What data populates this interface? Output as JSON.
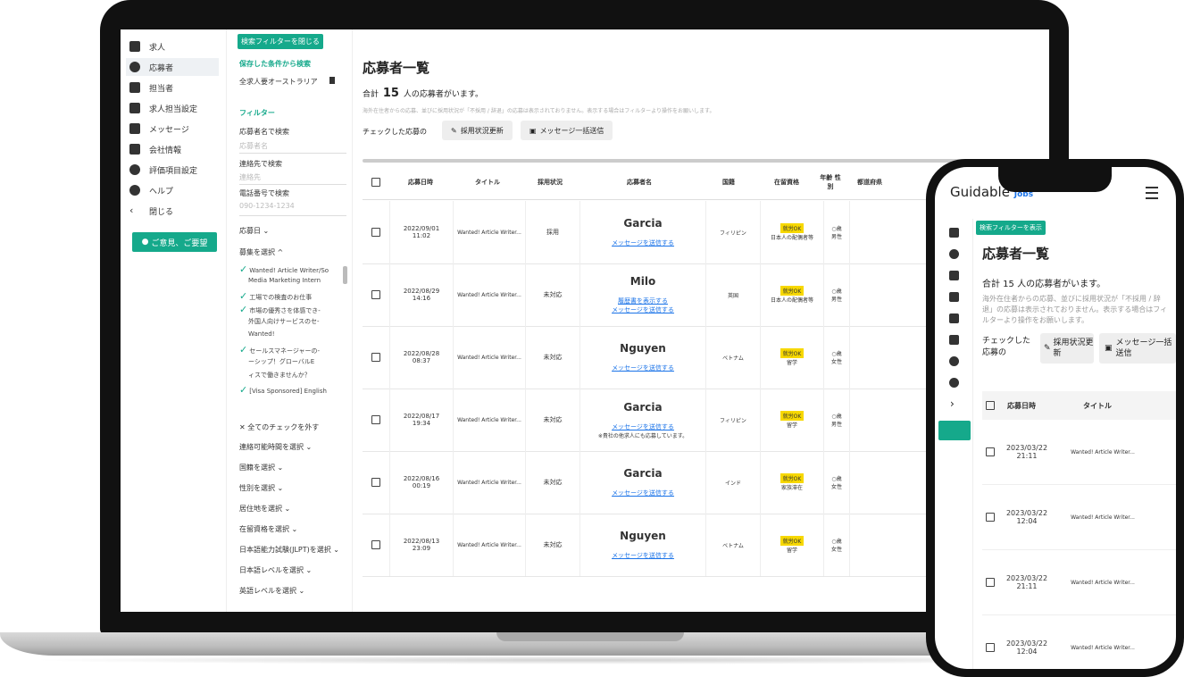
{
  "nav": {
    "items": [
      "求人",
      "応募者",
      "担当者",
      "求人担当設定",
      "メッセージ",
      "会社情報",
      "評価項目設定",
      "ヘルプ",
      "閉じる"
    ],
    "feedback": "ご意見、ご要望"
  },
  "filter": {
    "close_button": "検索フィルターを閉じる",
    "saved_label": "保存した条件から検索",
    "saved_value": "全求人要オーストラリア",
    "filter_title": "フィルター",
    "name_search": "応募者名で検索",
    "name_placeholder": "応募者名",
    "email_search": "連絡先で検索",
    "email_placeholder": "連絡先",
    "phone_search": "電話番号で検索",
    "phone_placeholder": "090-1234-1234",
    "apply_date": "応募日 ⌄",
    "job_select": "募集を選択 ^",
    "jobs": [
      {
        "checked": true,
        "label": "Wanted! Article Writer/So"
      },
      {
        "checked": false,
        "label": "Media Marketing Intern"
      },
      {
        "checked": true,
        "label": "工場での検査のお仕事"
      },
      {
        "checked": true,
        "label": "市場の優秀さを体感でき-"
      },
      {
        "checked": false,
        "label": "外国人向けサービスのセ-"
      },
      {
        "checked": false,
        "label": "Wanted!"
      },
      {
        "checked": true,
        "label": "セールスマネージャーの-"
      },
      {
        "checked": false,
        "label": "ーシップ！グローバルE"
      },
      {
        "checked": false,
        "label": "ィスで働きませんか？"
      },
      {
        "checked": true,
        "label": "[Visa Sponsored] English"
      }
    ],
    "clear_all": "✕ 全てのチェックを外す",
    "selects": [
      "連絡可能時間を選択 ⌄",
      "国籍を選択 ⌄",
      "性別を選択 ⌄",
      "居住地を選択 ⌄",
      "在留資格を選択 ⌄",
      "日本語能力試験(JLPT)を選択 ⌄",
      "日本語レベルを選択 ⌄",
      "英語レベルを選択 ⌄"
    ]
  },
  "main": {
    "title": "応募者一覧",
    "total_prefix": "合計",
    "total_count": "15",
    "total_suffix": "人の応募者がいます。",
    "note": "海外在住者からの応募、並びに採用状況が「不採用 / 辞退」の応募は表示されておりません。表示する場合はフィルターより操作をお願いします。",
    "action_label": "チェックした応募の",
    "update_button": "採用状況更新",
    "message_button": "メッセージ一括送信",
    "columns": [
      "応募日時",
      "タイトル",
      "採用状況",
      "応募者名",
      "国籍",
      "在留資格",
      "年齢 性別",
      "都道府県"
    ],
    "rows": [
      {
        "date": "2022/09/01",
        "time": "11:02",
        "title": "Wanted! Article Writer...",
        "status": "採用",
        "name": "Garcia",
        "links": [
          "メッセージを送信する"
        ],
        "extra": "",
        "country": "フィリピン",
        "badge": "就労OK",
        "visa": "日本人の配偶者等",
        "age": "○歳",
        "gender": "男性"
      },
      {
        "date": "2022/08/29",
        "time": "14:16",
        "title": "Wanted! Article Writer...",
        "status": "未対応",
        "name": "Milo",
        "links": [
          "履歴書を表示する",
          "メッセージを送信する"
        ],
        "extra": "",
        "country": "英国",
        "badge": "就労OK",
        "visa": "日本人の配偶者等",
        "age": "○歳",
        "gender": "男性"
      },
      {
        "date": "2022/08/28",
        "time": "08:37",
        "title": "Wanted! Article Writer...",
        "status": "未対応",
        "name": "Nguyen",
        "links": [
          "メッセージを送信する"
        ],
        "extra": "",
        "country": "ベトナム",
        "badge": "就労OK",
        "visa": "留学",
        "age": "○歳",
        "gender": "女性"
      },
      {
        "date": "2022/08/17",
        "time": "19:34",
        "title": "Wanted! Article Writer...",
        "status": "未対応",
        "name": "Garcia",
        "links": [
          "メッセージを送信する"
        ],
        "extra": "※貴社の他求人にも応募しています。",
        "country": "フィリピン",
        "badge": "就労OK",
        "visa": "留学",
        "age": "○歳",
        "gender": "男性"
      },
      {
        "date": "2022/08/16",
        "time": "00:19",
        "title": "Wanted! Article Writer...",
        "status": "未対応",
        "name": "Garcia",
        "links": [
          "メッセージを送信する"
        ],
        "extra": "",
        "country": "インド",
        "badge": "就労OK",
        "visa": "家族滞在",
        "age": "○歳",
        "gender": "女性"
      },
      {
        "date": "2022/08/13",
        "time": "23:09",
        "title": "Wanted! Article Writer...",
        "status": "未対応",
        "name": "Nguyen",
        "links": [
          "メッセージを送信する"
        ],
        "extra": "",
        "country": "ベトナム",
        "badge": "就労OK",
        "visa": "留学",
        "age": "○歳",
        "gender": "女性"
      }
    ]
  },
  "phone": {
    "logo": "Guidable",
    "logo_sub": "Jobs",
    "filter_button": "検索フィルターを表示",
    "title": "応募者一覧",
    "total": "合計 15 人の応募者がいます。",
    "note": "海外在住者からの応募、並びに採用状況が「不採用 / 辞退」の応募は表示されておりません。表示する場合はフィルターより操作をお願いします。",
    "action_label": "チェックした応募の",
    "update_button": "採用状況更新",
    "message_button": "メッセージ一括送信",
    "columns": [
      "応募日時",
      "タイトル"
    ],
    "rows": [
      {
        "date": "2023/03/22",
        "time": "21:11",
        "title": "Wanted! Article Writer..."
      },
      {
        "date": "2023/03/22",
        "time": "12:04",
        "title": "Wanted! Article Writer..."
      },
      {
        "date": "2023/03/22",
        "time": "21:11",
        "title": "Wanted! Article Writer..."
      },
      {
        "date": "2023/03/22",
        "time": "12:04",
        "title": "Wanted! Article Writer..."
      }
    ]
  },
  "colors": {
    "accent": "#15a98b",
    "link": "#1a73e8",
    "badge": "#f7d800"
  }
}
